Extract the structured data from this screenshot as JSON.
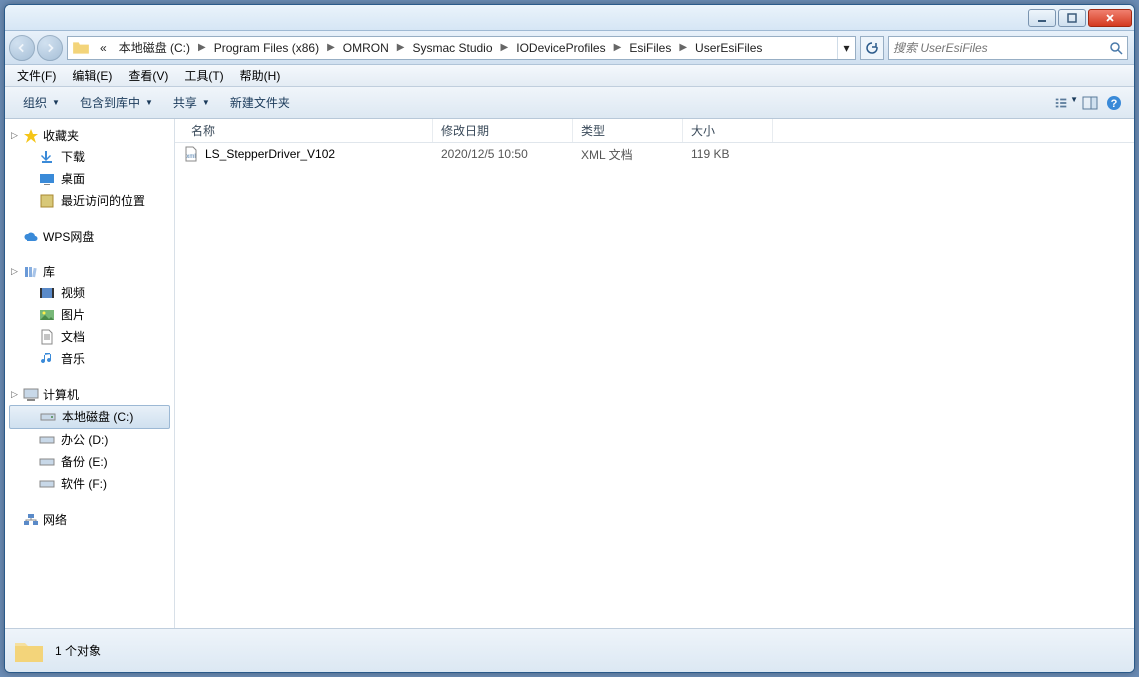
{
  "breadcrumb": {
    "prefix": "«",
    "parts": [
      "本地磁盘 (C:)",
      "Program Files (x86)",
      "OMRON",
      "Sysmac Studio",
      "IODeviceProfiles",
      "EsiFiles",
      "UserEsiFiles"
    ]
  },
  "search": {
    "placeholder": "搜索 UserEsiFiles"
  },
  "menubar": [
    "文件(F)",
    "编辑(E)",
    "查看(V)",
    "工具(T)",
    "帮助(H)"
  ],
  "toolbar": {
    "organize": "组织",
    "include": "包含到库中",
    "share": "共享",
    "newfolder": "新建文件夹"
  },
  "sidebar": {
    "favorites": {
      "label": "收藏夹",
      "items": [
        "下载",
        "桌面",
        "最近访问的位置"
      ]
    },
    "wps": {
      "label": "WPS网盘"
    },
    "libraries": {
      "label": "库",
      "items": [
        "视频",
        "图片",
        "文档",
        "音乐"
      ]
    },
    "computer": {
      "label": "计算机",
      "items": [
        "本地磁盘 (C:)",
        "办公 (D:)",
        "备份 (E:)",
        "软件 (F:)"
      ]
    },
    "network": {
      "label": "网络"
    }
  },
  "columns": {
    "name": "名称",
    "date": "修改日期",
    "type": "类型",
    "size": "大小"
  },
  "files": [
    {
      "name": "LS_StepperDriver_V102",
      "date": "2020/12/5 10:50",
      "type": "XML 文档",
      "size": "119 KB"
    }
  ],
  "status": {
    "count": "1 个对象"
  }
}
